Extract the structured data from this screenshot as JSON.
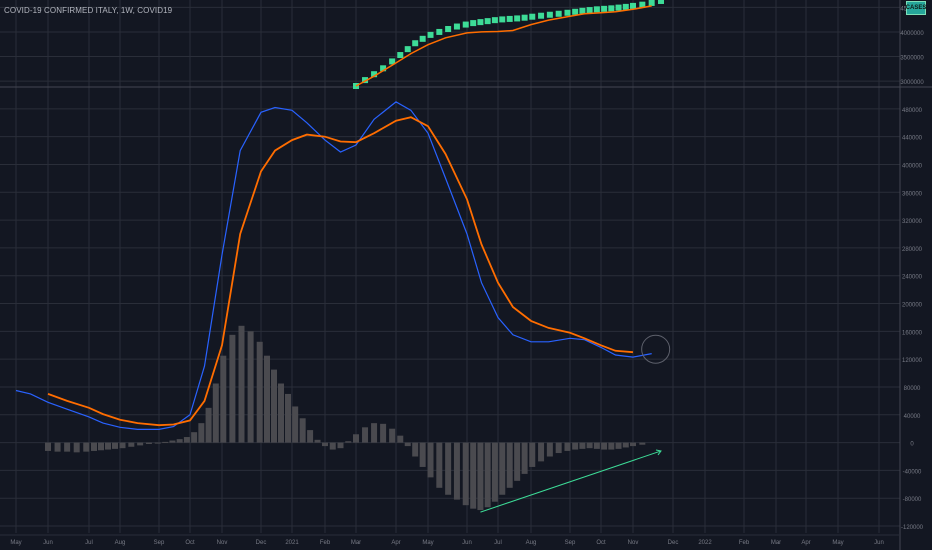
{
  "header": {
    "title": "COVID-19 CONFIRMED ITALY, 1W, COVID19",
    "badge": "CASES"
  },
  "colors": {
    "background": "#131722",
    "grid": "#2a2e39",
    "axis_text": "#787b86",
    "fast_line": "#2962ff",
    "slow_line": "#ff6d00",
    "hist": "#4a4a4f",
    "step": "#3ddc97",
    "divergence_line": "#3ddc97"
  },
  "chart_data": [
    {
      "type": "line",
      "title": "COVID-19 CONFIRMED ITALY, 1W, COVID19",
      "x_labels": [
        "May",
        "Jun",
        "Jul",
        "Aug",
        "Sep",
        "Oct",
        "Nov",
        "Dec",
        "2021",
        "Feb",
        "Mar",
        "Apr",
        "May",
        "Jun",
        "Jul",
        "Aug",
        "Sep",
        "Oct",
        "Nov",
        "Dec",
        "2022",
        "Feb",
        "Mar",
        "Apr",
        "May",
        "Jun"
      ],
      "y_ticks": [
        3000000,
        3500000,
        4000000,
        4500000
      ],
      "ylim": [
        2900000,
        4650000
      ],
      "series": [
        {
          "name": "CASES",
          "style": "step",
          "points": [
            [
              "2021-03-01",
              2900000
            ],
            [
              "2021-03-08",
              3020000
            ],
            [
              "2021-03-15",
              3140000
            ],
            [
              "2021-03-22",
              3260000
            ],
            [
              "2021-03-29",
              3400000
            ],
            [
              "2021-04-05",
              3530000
            ],
            [
              "2021-04-12",
              3650000
            ],
            [
              "2021-04-19",
              3770000
            ],
            [
              "2021-04-26",
              3860000
            ],
            [
              "2021-05-03",
              3940000
            ],
            [
              "2021-05-10",
              4000000
            ],
            [
              "2021-05-17",
              4060000
            ],
            [
              "2021-05-24",
              4110000
            ],
            [
              "2021-05-31",
              4150000
            ],
            [
              "2021-06-07",
              4180000
            ],
            [
              "2021-06-14",
              4200000
            ],
            [
              "2021-06-21",
              4220000
            ],
            [
              "2021-06-28",
              4240000
            ],
            [
              "2021-07-05",
              4255000
            ],
            [
              "2021-07-12",
              4265000
            ],
            [
              "2021-07-19",
              4275000
            ],
            [
              "2021-07-26",
              4290000
            ],
            [
              "2021-08-02",
              4310000
            ],
            [
              "2021-08-09",
              4330000
            ],
            [
              "2021-08-16",
              4350000
            ],
            [
              "2021-08-23",
              4370000
            ],
            [
              "2021-08-30",
              4390000
            ],
            [
              "2021-09-06",
              4410000
            ],
            [
              "2021-09-13",
              4430000
            ],
            [
              "2021-09-20",
              4445000
            ],
            [
              "2021-09-27",
              4460000
            ],
            [
              "2021-10-04",
              4470000
            ],
            [
              "2021-10-11",
              4480000
            ],
            [
              "2021-10-18",
              4495000
            ],
            [
              "2021-10-25",
              4510000
            ],
            [
              "2021-11-01",
              4530000
            ],
            [
              "2021-11-08",
              4555000
            ],
            [
              "2021-11-15",
              4590000
            ],
            [
              "2021-11-22",
              4630000
            ]
          ]
        },
        {
          "name": "",
          "style": "line",
          "points": [
            [
              "2021-03-01",
              2900000
            ],
            [
              "2021-03-15",
              3100000
            ],
            [
              "2021-04-01",
              3370000
            ],
            [
              "2021-04-15",
              3560000
            ],
            [
              "2021-05-01",
              3740000
            ],
            [
              "2021-05-15",
              3880000
            ],
            [
              "2021-06-01",
              3980000
            ],
            [
              "2021-06-15",
              4000000
            ],
            [
              "2021-07-01",
              4010000
            ],
            [
              "2021-07-15",
              4030000
            ],
            [
              "2021-08-01",
              4150000
            ],
            [
              "2021-08-15",
              4240000
            ],
            [
              "2021-09-01",
              4320000
            ],
            [
              "2021-09-15",
              4370000
            ],
            [
              "2021-10-01",
              4390000
            ],
            [
              "2021-10-15",
              4410000
            ],
            [
              "2021-11-01",
              4460000
            ],
            [
              "2021-11-15",
              4530000
            ]
          ]
        }
      ]
    },
    {
      "type": "line",
      "x_labels": [
        "May",
        "Jun",
        "Jul",
        "Aug",
        "Sep",
        "Oct",
        "Nov",
        "Dec",
        "2021",
        "Feb",
        "Mar",
        "Apr",
        "May",
        "Jun",
        "Jul",
        "Aug",
        "Sep",
        "Oct",
        "Nov",
        "Dec",
        "2022",
        "Feb",
        "Mar",
        "Apr",
        "May",
        "Jun"
      ],
      "y_ticks": [
        -120000,
        -80000,
        -40000,
        0,
        40000,
        80000,
        120000,
        160000,
        200000,
        240000,
        280000,
        320000,
        360000,
        400000,
        440000,
        480000
      ],
      "ylim": [
        -130000,
        510000
      ],
      "series": [
        {
          "name": "",
          "color_key": "fast_line",
          "points": [
            [
              "2020-05-01",
              75000
            ],
            [
              "2020-05-15",
              70000
            ],
            [
              "2020-06-01",
              58000
            ],
            [
              "2020-06-15",
              48000
            ],
            [
              "2020-07-01",
              37000
            ],
            [
              "2020-07-15",
              28000
            ],
            [
              "2020-08-01",
              22000
            ],
            [
              "2020-08-15",
              19000
            ],
            [
              "2020-09-01",
              19000
            ],
            [
              "2020-09-15",
              23000
            ],
            [
              "2020-10-01",
              40000
            ],
            [
              "2020-10-15",
              110000
            ],
            [
              "2020-11-01",
              270000
            ],
            [
              "2020-11-15",
              420000
            ],
            [
              "2020-12-01",
              475000
            ],
            [
              "2020-12-15",
              482000
            ],
            [
              "2021-01-01",
              478000
            ],
            [
              "2021-01-15",
              460000
            ],
            [
              "2021-02-01",
              435000
            ],
            [
              "2021-02-15",
              418000
            ],
            [
              "2021-03-01",
              428000
            ],
            [
              "2021-03-15",
              465000
            ],
            [
              "2021-04-01",
              490000
            ],
            [
              "2021-04-15",
              478000
            ],
            [
              "2021-05-01",
              445000
            ],
            [
              "2021-05-15",
              380000
            ],
            [
              "2021-06-01",
              300000
            ],
            [
              "2021-06-15",
              230000
            ],
            [
              "2021-07-01",
              180000
            ],
            [
              "2021-07-15",
              155000
            ],
            [
              "2021-08-01",
              145000
            ],
            [
              "2021-08-15",
              145000
            ],
            [
              "2021-09-01",
              150000
            ],
            [
              "2021-09-15",
              148000
            ],
            [
              "2021-10-01",
              137000
            ],
            [
              "2021-10-15",
              126000
            ],
            [
              "2021-11-01",
              123000
            ],
            [
              "2021-11-15",
              128000
            ]
          ]
        },
        {
          "name": "",
          "color_key": "slow_line",
          "points": [
            [
              "2020-06-01",
              70000
            ],
            [
              "2020-06-15",
              60000
            ],
            [
              "2020-07-01",
              50000
            ],
            [
              "2020-07-15",
              41000
            ],
            [
              "2020-08-01",
              33000
            ],
            [
              "2020-08-15",
              28000
            ],
            [
              "2020-09-01",
              25000
            ],
            [
              "2020-09-15",
              26000
            ],
            [
              "2020-10-01",
              32000
            ],
            [
              "2020-10-15",
              60000
            ],
            [
              "2020-11-01",
              140000
            ],
            [
              "2020-11-15",
              300000
            ],
            [
              "2020-12-01",
              390000
            ],
            [
              "2020-12-15",
              420000
            ],
            [
              "2021-01-01",
              435000
            ],
            [
              "2021-01-15",
              443000
            ],
            [
              "2021-02-01",
              440000
            ],
            [
              "2021-02-15",
              433000
            ],
            [
              "2021-03-01",
              432000
            ],
            [
              "2021-03-15",
              445000
            ],
            [
              "2021-04-01",
              463000
            ],
            [
              "2021-04-15",
              468000
            ],
            [
              "2021-05-01",
              455000
            ],
            [
              "2021-05-15",
              415000
            ],
            [
              "2021-06-01",
              350000
            ],
            [
              "2021-06-15",
              285000
            ],
            [
              "2021-07-01",
              230000
            ],
            [
              "2021-07-15",
              195000
            ],
            [
              "2021-08-01",
              175000
            ],
            [
              "2021-08-15",
              165000
            ],
            [
              "2021-09-01",
              158000
            ],
            [
              "2021-09-15",
              150000
            ],
            [
              "2021-10-01",
              140000
            ],
            [
              "2021-10-15",
              132000
            ],
            [
              "2021-11-01",
              130000
            ]
          ]
        }
      ],
      "histogram": [
        [
          "2020-06-01",
          -12000
        ],
        [
          "2020-06-08",
          -13000
        ],
        [
          "2020-06-15",
          -13000
        ],
        [
          "2020-06-22",
          -14000
        ],
        [
          "2020-06-29",
          -13000
        ],
        [
          "2020-07-06",
          -12000
        ],
        [
          "2020-07-13",
          -11000
        ],
        [
          "2020-07-20",
          -10000
        ],
        [
          "2020-07-27",
          -9000
        ],
        [
          "2020-08-03",
          -8000
        ],
        [
          "2020-08-10",
          -6000
        ],
        [
          "2020-08-17",
          -4000
        ],
        [
          "2020-08-24",
          -2000
        ],
        [
          "2020-08-31",
          -1000
        ],
        [
          "2020-09-07",
          1000
        ],
        [
          "2020-09-14",
          3000
        ],
        [
          "2020-09-21",
          5000
        ],
        [
          "2020-09-28",
          8000
        ],
        [
          "2020-10-05",
          15000
        ],
        [
          "2020-10-12",
          28000
        ],
        [
          "2020-10-19",
          50000
        ],
        [
          "2020-10-26",
          85000
        ],
        [
          "2020-11-02",
          125000
        ],
        [
          "2020-11-09",
          155000
        ],
        [
          "2020-11-16",
          168000
        ],
        [
          "2020-11-23",
          160000
        ],
        [
          "2020-11-30",
          145000
        ],
        [
          "2020-12-07",
          125000
        ],
        [
          "2020-12-14",
          105000
        ],
        [
          "2020-12-21",
          85000
        ],
        [
          "2020-12-28",
          70000
        ],
        [
          "2021-01-04",
          52000
        ],
        [
          "2021-01-11",
          35000
        ],
        [
          "2021-01-18",
          18000
        ],
        [
          "2021-01-25",
          4000
        ],
        [
          "2021-02-01",
          -5000
        ],
        [
          "2021-02-08",
          -10000
        ],
        [
          "2021-02-15",
          -8000
        ],
        [
          "2021-02-22",
          2000
        ],
        [
          "2021-03-01",
          12000
        ],
        [
          "2021-03-08",
          22000
        ],
        [
          "2021-03-15",
          28000
        ],
        [
          "2021-03-22",
          27000
        ],
        [
          "2021-03-29",
          20000
        ],
        [
          "2021-04-05",
          10000
        ],
        [
          "2021-04-12",
          -5000
        ],
        [
          "2021-04-19",
          -20000
        ],
        [
          "2021-04-26",
          -35000
        ],
        [
          "2021-05-03",
          -50000
        ],
        [
          "2021-05-10",
          -65000
        ],
        [
          "2021-05-17",
          -75000
        ],
        [
          "2021-05-24",
          -82000
        ],
        [
          "2021-05-31",
          -90000
        ],
        [
          "2021-06-07",
          -95000
        ],
        [
          "2021-06-14",
          -97000
        ],
        [
          "2021-06-21",
          -93000
        ],
        [
          "2021-06-28",
          -85000
        ],
        [
          "2021-07-05",
          -75000
        ],
        [
          "2021-07-12",
          -65000
        ],
        [
          "2021-07-19",
          -55000
        ],
        [
          "2021-07-26",
          -45000
        ],
        [
          "2021-08-02",
          -35000
        ],
        [
          "2021-08-09",
          -27000
        ],
        [
          "2021-08-16",
          -20000
        ],
        [
          "2021-08-23",
          -15000
        ],
        [
          "2021-08-30",
          -12000
        ],
        [
          "2021-09-06",
          -10000
        ],
        [
          "2021-09-13",
          -9000
        ],
        [
          "2021-09-20",
          -8000
        ],
        [
          "2021-09-27",
          -9000
        ],
        [
          "2021-10-04",
          -10000
        ],
        [
          "2021-10-11",
          -10000
        ],
        [
          "2021-10-18",
          -9000
        ],
        [
          "2021-10-25",
          -7000
        ],
        [
          "2021-11-01",
          -5000
        ],
        [
          "2021-11-08",
          -3000
        ]
      ],
      "divergence_line": [
        [
          "2021-06-14",
          -100000
        ],
        [
          "2021-11-22",
          -12000
        ]
      ],
      "marker_circle_at": [
        "2021-11-15",
        130000
      ]
    }
  ]
}
